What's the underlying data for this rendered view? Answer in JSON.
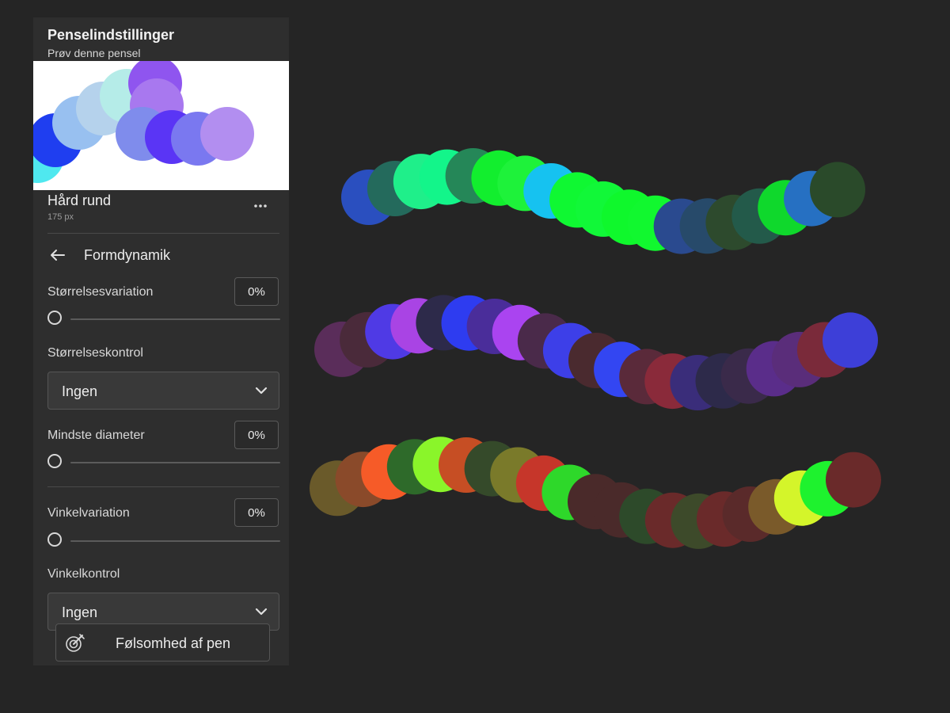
{
  "panel": {
    "title": "Penselindstillinger",
    "subtitle": "Prøv denne pensel",
    "preview_dab_colors": [
      "#4fe8ef",
      "#1f3ef0",
      "#98c0f0",
      "#b5d2ec",
      "#b5ece8",
      "#8f55ef",
      "#a878ef",
      "#7f8cec",
      "#5a35f5",
      "#7a78f0",
      "#b28ef0"
    ],
    "brush": {
      "name": "Hård rund",
      "size": "175 px"
    },
    "more_icon": "more-horizontal-icon",
    "section": {
      "back_icon": "arrow-left-icon",
      "title": "Formdynamik"
    },
    "size_variation": {
      "label": "Størrelsesvariation",
      "value": "0%",
      "level": 0
    },
    "size_control": {
      "label": "Størrelseskontrol",
      "selected": "Ingen",
      "icon": "chevron-down-icon"
    },
    "min_diameter": {
      "label": "Mindste diameter",
      "value": "0%",
      "level": 0
    },
    "angle_variation": {
      "label": "Vinkelvariation",
      "value": "0%",
      "level": 0
    },
    "angle_control": {
      "label": "Vinkelkontrol",
      "selected": "Ingen",
      "icon": "chevron-down-icon"
    },
    "pen_sensitivity": {
      "label": "Følsomhed af pen",
      "icon": "pen-pressure-icon"
    }
  },
  "canvas": {
    "strokes": [
      {
        "colors": [
          "#2a4fbf",
          "#246a5c",
          "#1fef8a",
          "#13f58a",
          "#258758",
          "#12ee2e",
          "#1ef23a",
          "#16c2f0",
          "#0ff832",
          "#11f838",
          "#0ff82c",
          "#11f82f",
          "#2a4a8f",
          "#274a6a",
          "#2d4a2d",
          "#235a4a",
          "#0fd82c",
          "#2670c2",
          "#2a4a2a"
        ]
      },
      {
        "colors": [
          "#5a2d5a",
          "#4a2a3a",
          "#4f3ae5",
          "#a944e4",
          "#2d2a4a",
          "#2e3cf0",
          "#4a2d9a",
          "#aa44f0",
          "#4a2a4a",
          "#3d3fe8",
          "#4a2a2f",
          "#3346f2",
          "#5a2a3a",
          "#8a2a3a",
          "#3a2d7a",
          "#2d2a4a",
          "#3a2a4a",
          "#5a2d8a",
          "#5a2d7a",
          "#7a2a3a",
          "#3d3fd8"
        ]
      },
      {
        "colors": [
          "#6a5a2a",
          "#8a4a2a",
          "#f65b28",
          "#2e6a2a",
          "#8af52a",
          "#c64e24",
          "#354a2a",
          "#7a7a2a",
          "#c6362a",
          "#2ed82a",
          "#4a2a2a",
          "#4a2a2a",
          "#2d4a2a",
          "#6a2a2a",
          "#3d4a2a",
          "#6a2a2a",
          "#5a2a2a",
          "#7a5a2a",
          "#d4f52a",
          "#1ef22e",
          "#6a2a2a"
        ]
      }
    ]
  }
}
